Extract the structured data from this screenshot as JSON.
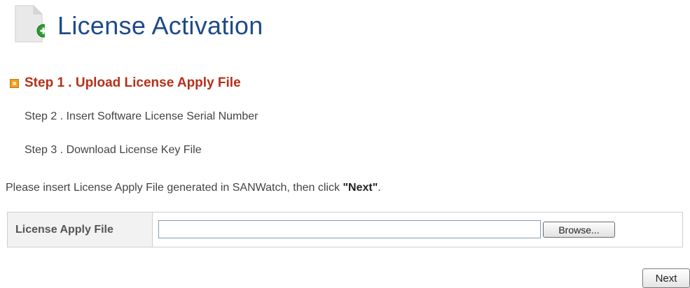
{
  "page": {
    "title": "License Activation",
    "icon": "document-add-icon"
  },
  "steps": {
    "active": "Step 1 . Upload License Apply File",
    "step2": "Step 2 . Insert Software License Serial Number",
    "step3": "Step 3 . Download License Key File"
  },
  "instruction": {
    "prefix": "Please insert License Apply File generated in SANWatch, then click ",
    "emphasis": "\"Next\"",
    "suffix": "."
  },
  "form": {
    "field_label": "License Apply File",
    "file_value": "",
    "browse_label": "Browse..."
  },
  "actions": {
    "next_label": "Next"
  },
  "colors": {
    "title": "#1e4a8a",
    "active_step": "#b5301a",
    "bullet": "#f0a020"
  }
}
